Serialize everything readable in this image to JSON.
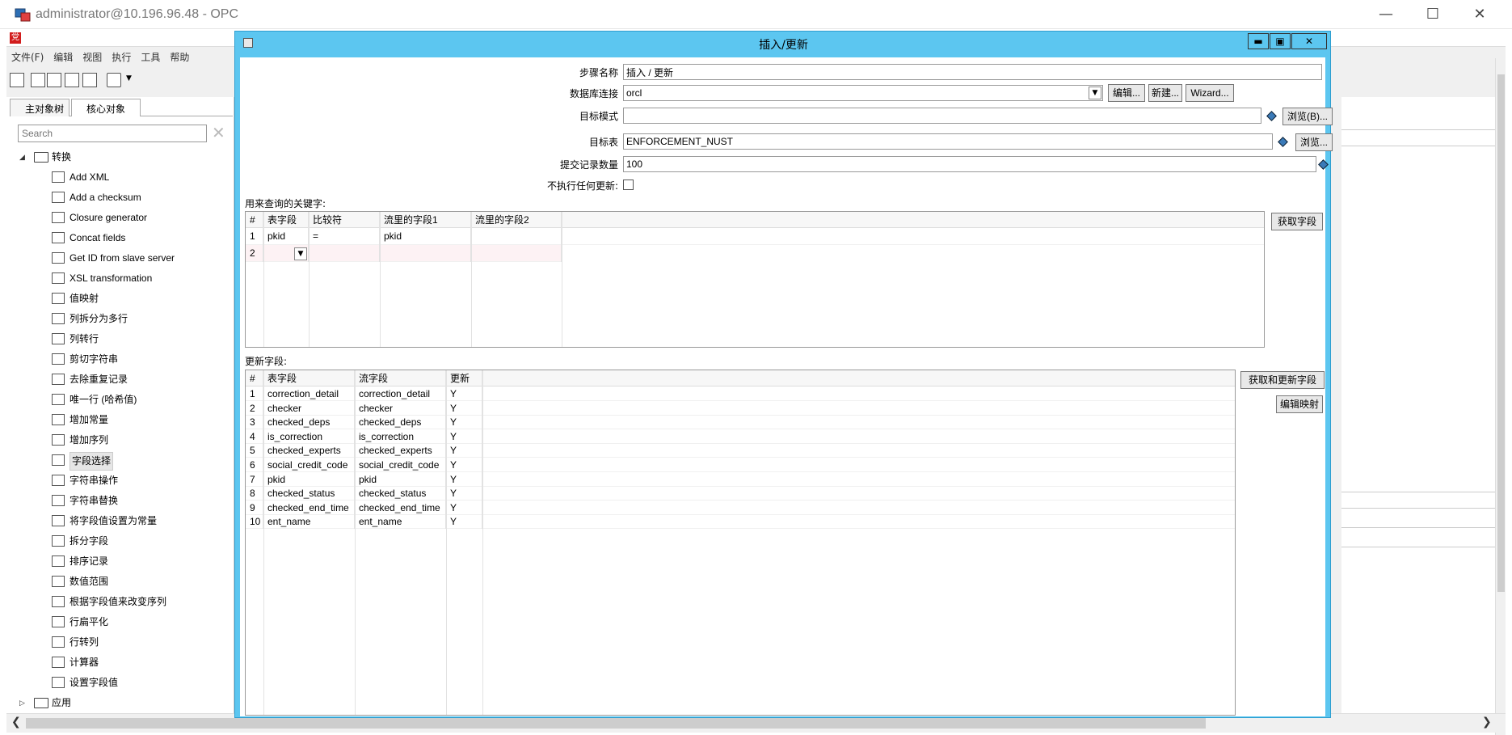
{
  "window": {
    "title": "administrator@10.196.96.48 - OPC",
    "minimize": "—",
    "maximize": "☐",
    "close": "✕"
  },
  "app": {
    "logo": "党",
    "menu": [
      "文件(F)",
      "编辑",
      "视图",
      "执行",
      "工具",
      "帮助"
    ],
    "tabs": [
      "主对象树",
      "核心对象"
    ],
    "search_placeholder": "Search",
    "tree_root": "转换",
    "tree_items": [
      "Add XML",
      "Add a checksum",
      "Closure generator",
      "Concat fields",
      "Get ID from slave server",
      "XSL transformation",
      "值映射",
      "列拆分为多行",
      "列转行",
      "剪切字符串",
      "去除重复记录",
      "唯一行 (哈希值)",
      "增加常量",
      "增加序列",
      "字段选择",
      "字符串操作",
      "字符串替换",
      "将字段值设置为常量",
      "拆分字段",
      "排序记录",
      "数值范围",
      "根据字段值来改变序列",
      "行扁平化",
      "行转列",
      "计算器",
      "设置字段值"
    ],
    "tree_footer": "应用"
  },
  "dialog": {
    "title": "插入/更新",
    "ctrl_min": "▬",
    "ctrl_max": "▣",
    "ctrl_close": "✕",
    "step_name_label": "步骤名称",
    "step_name": "插入 / 更新",
    "connection_label": "数据库连接",
    "connection": "orcl",
    "edit_btn": "编辑...",
    "new_btn": "新建...",
    "wizard_btn": "Wizard...",
    "schema_label": "目标模式",
    "schema": "",
    "browse_btn": "浏览(B)...",
    "table_label": "目标表",
    "table": "ENFORCEMENT_NUST",
    "browse2_btn": "浏览...",
    "commit_label": "提交记录数量",
    "commit": "100",
    "noupdate_label": "不执行任何更新:",
    "keys_label": "用来查询的关键字:",
    "keys_headers": [
      "#",
      "表字段",
      "比较符",
      "流里的字段1",
      "流里的字段2"
    ],
    "keys_rows": [
      [
        "1",
        "pkid",
        "=",
        "pkid",
        ""
      ],
      [
        "2",
        "",
        "",
        "",
        ""
      ]
    ],
    "get_fields_btn": "获取字段",
    "update_label": "更新字段:",
    "update_headers": [
      "#",
      "表字段",
      "流字段",
      "更新"
    ],
    "update_rows": [
      [
        "1",
        "correction_detail",
        "correction_detail",
        "Y"
      ],
      [
        "2",
        "checker",
        "checker",
        "Y"
      ],
      [
        "3",
        "checked_deps",
        "checked_deps",
        "Y"
      ],
      [
        "4",
        "is_correction",
        "is_correction",
        "Y"
      ],
      [
        "5",
        "checked_experts",
        "checked_experts",
        "Y"
      ],
      [
        "6",
        "social_credit_code",
        "social_credit_code",
        "Y"
      ],
      [
        "7",
        "pkid",
        "pkid",
        "Y"
      ],
      [
        "8",
        "checked_status",
        "checked_status",
        "Y"
      ],
      [
        "9",
        "checked_end_time",
        "checked_end_time",
        "Y"
      ],
      [
        "10",
        "ent_name",
        "ent_name",
        "Y"
      ]
    ],
    "get_update_btn": "获取和更新字段",
    "edit_mapping_btn": "编辑映射"
  },
  "colors": {
    "dialog_border": "#5cc6f0",
    "logo_red": "#d21c1c"
  }
}
